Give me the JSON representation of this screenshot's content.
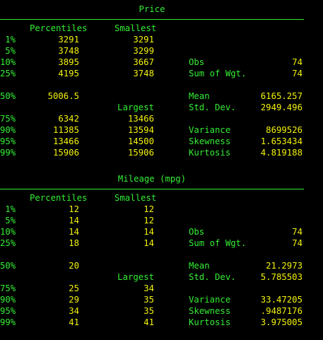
{
  "window": {
    "background": "#000000",
    "text_color": "#33ee33",
    "value_color": "#f2f20a"
  },
  "tables": [
    {
      "title": "Price",
      "headers": {
        "percentiles": "Percentiles",
        "smallest": "Smallest",
        "largest": "Largest"
      },
      "rows": [
        {
          "pct": "1%",
          "p": "3291",
          "o": "3291",
          "stat": "",
          "val": ""
        },
        {
          "pct": "5%",
          "p": "3748",
          "o": "3299",
          "stat": "",
          "val": ""
        },
        {
          "pct": "10%",
          "p": "3895",
          "o": "3667",
          "stat": "Obs",
          "val": "74"
        },
        {
          "pct": "25%",
          "p": "4195",
          "o": "3748",
          "stat": "Sum of Wgt.",
          "val": "74"
        },
        {
          "pct": "50%",
          "p": "5006.5",
          "o": "",
          "stat": "Mean",
          "val": "6165.257"
        },
        {
          "pct": "",
          "p": "",
          "o": "",
          "stat": "Std. Dev.",
          "val": "2949.496"
        },
        {
          "pct": "75%",
          "p": "6342",
          "o": "13466",
          "stat": "",
          "val": ""
        },
        {
          "pct": "90%",
          "p": "11385",
          "o": "13594",
          "stat": "Variance",
          "val": "8699526"
        },
        {
          "pct": "95%",
          "p": "13466",
          "o": "14500",
          "stat": "Skewness",
          "val": "1.653434"
        },
        {
          "pct": "99%",
          "p": "15906",
          "o": "15906",
          "stat": "Kurtosis",
          "val": "4.819188"
        }
      ]
    },
    {
      "title": "Mileage (mpg)",
      "headers": {
        "percentiles": "Percentiles",
        "smallest": "Smallest",
        "largest": "Largest"
      },
      "rows": [
        {
          "pct": "1%",
          "p": "12",
          "o": "12",
          "stat": "",
          "val": ""
        },
        {
          "pct": "5%",
          "p": "14",
          "o": "12",
          "stat": "",
          "val": ""
        },
        {
          "pct": "10%",
          "p": "14",
          "o": "14",
          "stat": "Obs",
          "val": "74"
        },
        {
          "pct": "25%",
          "p": "18",
          "o": "14",
          "stat": "Sum of Wgt.",
          "val": "74"
        },
        {
          "pct": "50%",
          "p": "20",
          "o": "",
          "stat": "Mean",
          "val": "21.2973"
        },
        {
          "pct": "",
          "p": "",
          "o": "",
          "stat": "Std. Dev.",
          "val": "5.785503"
        },
        {
          "pct": "75%",
          "p": "25",
          "o": "34",
          "stat": "",
          "val": ""
        },
        {
          "pct": "90%",
          "p": "29",
          "o": "35",
          "stat": "Variance",
          "val": "33.47205"
        },
        {
          "pct": "95%",
          "p": "34",
          "o": "35",
          "stat": "Skewness",
          "val": ".9487176"
        },
        {
          "pct": "99%",
          "p": "41",
          "o": "41",
          "stat": "Kurtosis",
          "val": "3.975005"
        }
      ]
    }
  ]
}
